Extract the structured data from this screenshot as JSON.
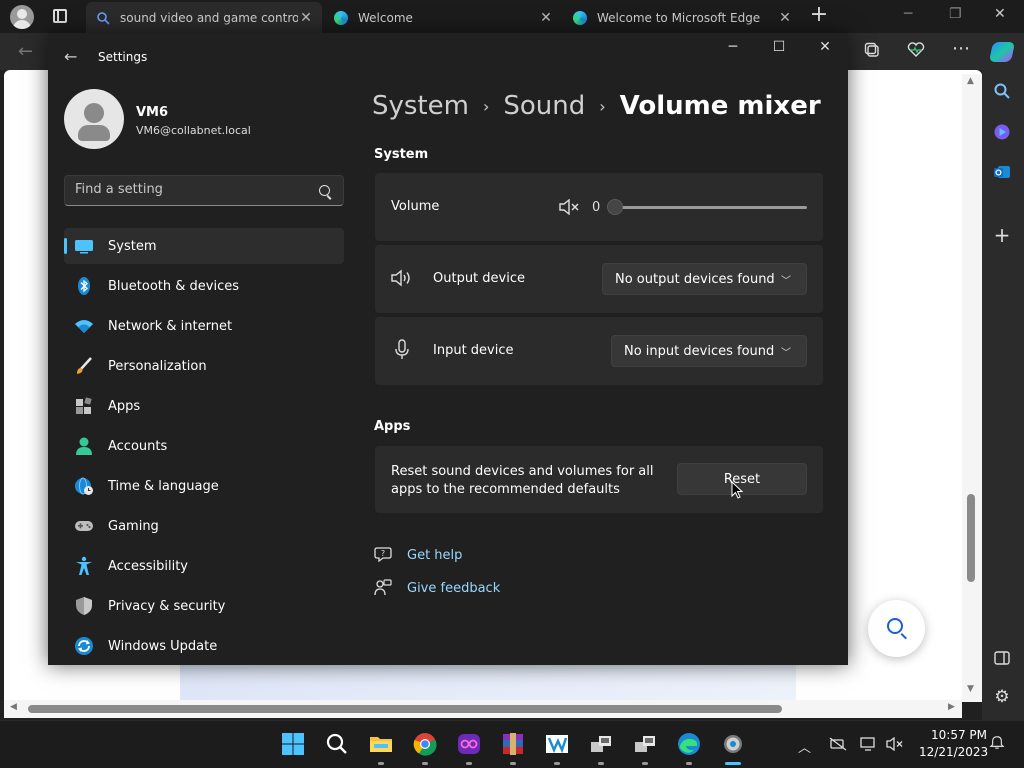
{
  "browser": {
    "tabs": [
      {
        "title": "sound video and game controlle",
        "close": "✕"
      },
      {
        "title": "Welcome",
        "close": "✕"
      },
      {
        "title": "Welcome to Microsoft Edge",
        "close": "✕"
      }
    ],
    "new_tab": "+"
  },
  "settings": {
    "window_title": "Settings",
    "user": {
      "name": "VM6",
      "email": "VM6@collabnet.local"
    },
    "search": {
      "placeholder": "Find a setting"
    },
    "nav": [
      {
        "label": "System",
        "icon": "monitor-icon",
        "active": true
      },
      {
        "label": "Bluetooth & devices",
        "icon": "bluetooth-icon"
      },
      {
        "label": "Network & internet",
        "icon": "wifi-icon"
      },
      {
        "label": "Personalization",
        "icon": "brush-icon"
      },
      {
        "label": "Apps",
        "icon": "apps-icon"
      },
      {
        "label": "Accounts",
        "icon": "person-icon"
      },
      {
        "label": "Time & language",
        "icon": "globe-clock-icon"
      },
      {
        "label": "Gaming",
        "icon": "gamepad-icon"
      },
      {
        "label": "Accessibility",
        "icon": "accessibility-icon"
      },
      {
        "label": "Privacy & security",
        "icon": "shield-icon"
      },
      {
        "label": "Windows Update",
        "icon": "update-icon"
      }
    ],
    "breadcrumb": {
      "first": "System",
      "second": "Sound",
      "current": "Volume mixer",
      "separator": "›"
    },
    "system_section": {
      "title": "System",
      "volume": {
        "label": "Volume",
        "value": "0",
        "level": 0
      },
      "output": {
        "label": "Output device",
        "selected": "No output devices found"
      },
      "input": {
        "label": "Input device",
        "selected": "No input devices found"
      }
    },
    "apps_section": {
      "title": "Apps",
      "reset_text": "Reset sound devices and volumes for all apps to the recommended defaults",
      "reset_button": "Reset"
    },
    "links": {
      "get_help": "Get help",
      "give_feedback": "Give feedback"
    }
  },
  "taskbar": {
    "clock": {
      "time": "10:57 PM",
      "date": "12/21/2023"
    }
  },
  "colors": {
    "accent": "#4cc2ff",
    "link": "#9ad7ff",
    "window_bg": "#202020",
    "card_bg": "#2b2b2b"
  }
}
